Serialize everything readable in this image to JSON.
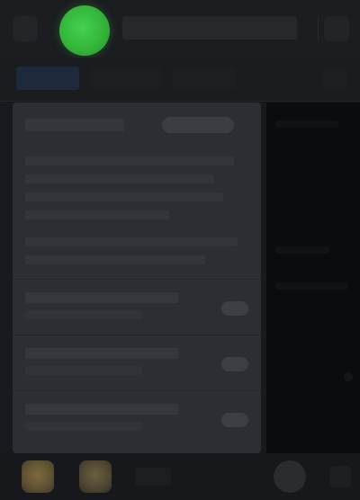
{
  "app": {
    "title": ""
  },
  "tabs": [
    {
      "label": ""
    },
    {
      "label": ""
    },
    {
      "label": ""
    }
  ],
  "card": {
    "header": "",
    "badge": "",
    "rows": [
      {
        "title": "",
        "subtitle": ""
      },
      {
        "title": "",
        "subtitle": ""
      },
      {
        "title": "",
        "subtitle": ""
      }
    ]
  },
  "toolbar": {
    "action_label": ""
  },
  "icons": {
    "app_icon": "green-circle-app-icon",
    "menu": "menu-icon",
    "more": "more-icon",
    "avatar_primary": "avatar-icon",
    "avatar_secondary": "avatar-icon"
  },
  "colors": {
    "accent_green": "#3fc646",
    "background": "#17191c",
    "card": "#2b2e32",
    "panel_dark": "#0b0c0e",
    "tab_active": "#1e2a3b"
  }
}
